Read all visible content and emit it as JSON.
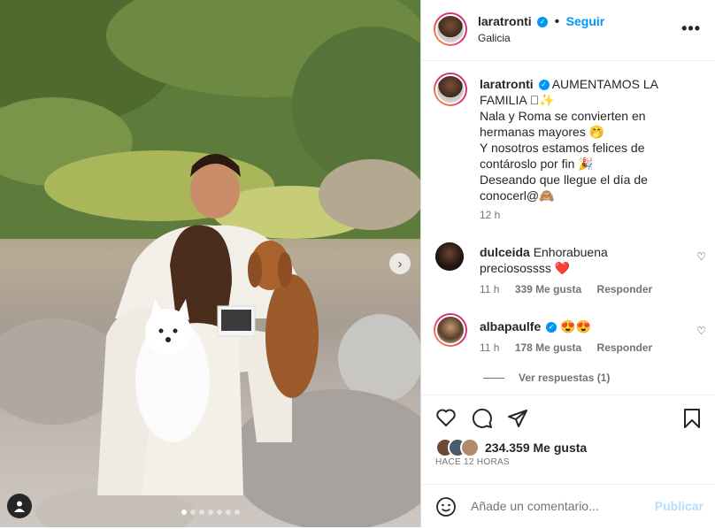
{
  "post": {
    "carousel": {
      "count": 7,
      "active_index": 0
    }
  },
  "header": {
    "username": "laratronti",
    "follow_label": "Seguir",
    "location": "Galicia",
    "more": "•••"
  },
  "caption": {
    "username": "laratronti",
    "lines": [
      "AUMENTAMOS LA",
      "FAMILIA 🏼✨",
      "Nala y Roma se convierten en",
      "hermanas mayores 🤭",
      "Y nosotros estamos felices de",
      "contároslo por fin 🎉",
      "Deseando que llegue el día de",
      "conocerl@🙈"
    ],
    "time": "12 h"
  },
  "comments": [
    {
      "username": "dulceida",
      "text": "Enhorabuena",
      "text2": "preciosossss ❤️",
      "time": "11 h",
      "likes": "339 Me gusta",
      "reply": "Responder"
    },
    {
      "username": "albapaulfe",
      "text": "😍😍",
      "time": "11 h",
      "likes": "178 Me gusta",
      "reply": "Responder"
    }
  ],
  "replies_label": "Ver respuestas (1)",
  "likes": {
    "count_label": "234.359 Me gusta",
    "time_label": "HACE 12 HORAS"
  },
  "comment_box": {
    "placeholder": "Añade un comentario...",
    "publish": "Publicar"
  },
  "colors": {
    "accent": "#0095f6",
    "publish_disabled": "#b2dffc",
    "like_heart": "#ed4956"
  }
}
